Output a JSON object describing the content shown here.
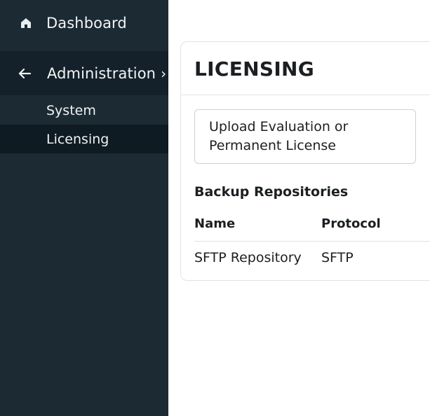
{
  "sidebar": {
    "dashboard": {
      "label": "Dashboard",
      "icon": "home-icon"
    },
    "administration": {
      "label": "Administration",
      "icon": "arrow-left-icon",
      "chevron": "›"
    },
    "subitems": [
      {
        "label": "System"
      },
      {
        "label": "Licensing",
        "active": true
      }
    ]
  },
  "main": {
    "title": "LICENSING",
    "upload_button": {
      "line1": "Upload Evaluation or",
      "line2": "Permanent License"
    },
    "repositories": {
      "heading": "Backup Repositories",
      "columns": [
        "Name",
        "Protocol"
      ],
      "rows": [
        [
          "SFTP Repository",
          "SFTP"
        ]
      ]
    }
  },
  "colors": {
    "sidebar_bg": "#1c2a33",
    "sidebar_active_bg": "#0f1b22",
    "text_dark": "#1b1f22",
    "border": "#dfe4e6"
  }
}
